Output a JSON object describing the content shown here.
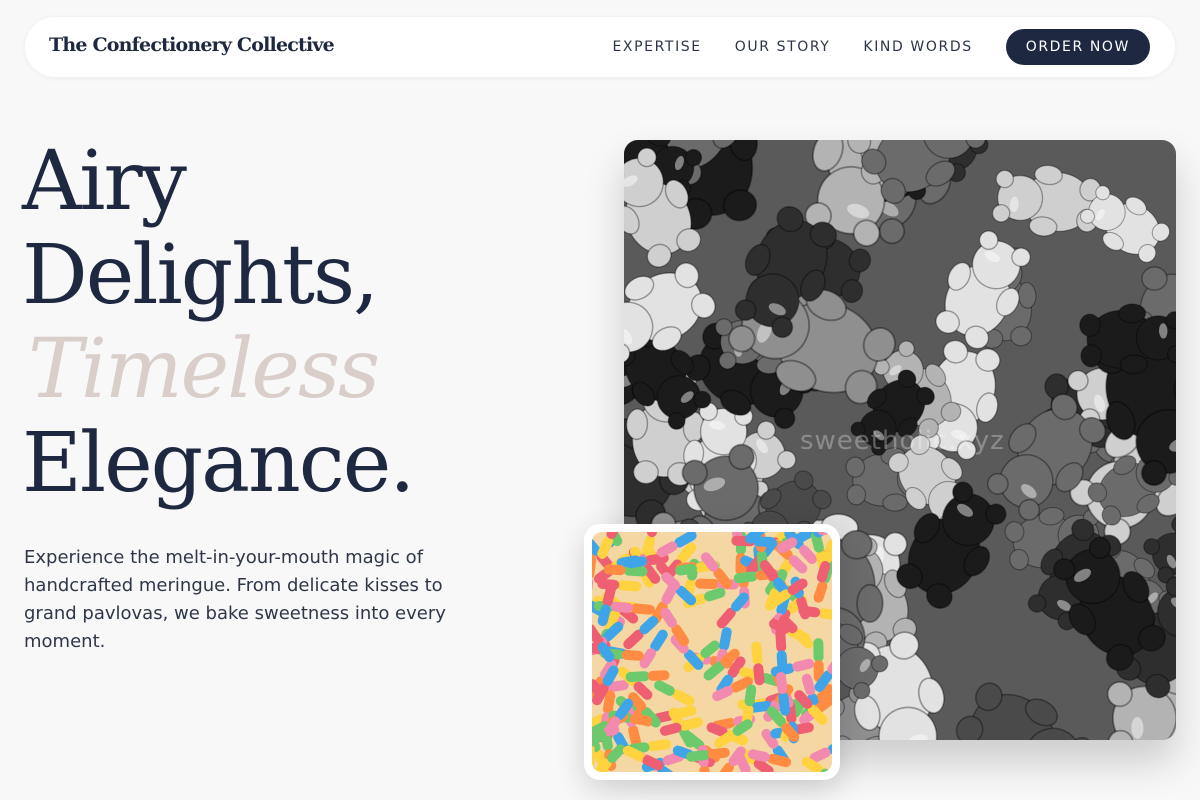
{
  "brand": "The Confectionery Collective",
  "nav": {
    "links": [
      "EXPERTISE",
      "OUR STORY",
      "KIND WORDS"
    ],
    "cta": "ORDER NOW"
  },
  "hero": {
    "line1": "Airy",
    "line2": "Delights,",
    "line3": "Timeless",
    "line4": "Elegance.",
    "intro": "Experience the melt-in-your-mouth magic of handcrafted meringue. From delicate kisses to grand pavlovas, we bake sweetness into every moment."
  },
  "images": {
    "main_subject": "black-and-white-gummy-bears",
    "main_watermark": "sweetholic.xyz",
    "inset_subject": "sour-gummy-worms"
  },
  "colors": {
    "navy": "#1e2840",
    "accent_text": "#d9ceca",
    "background": "#f8f8f8"
  }
}
